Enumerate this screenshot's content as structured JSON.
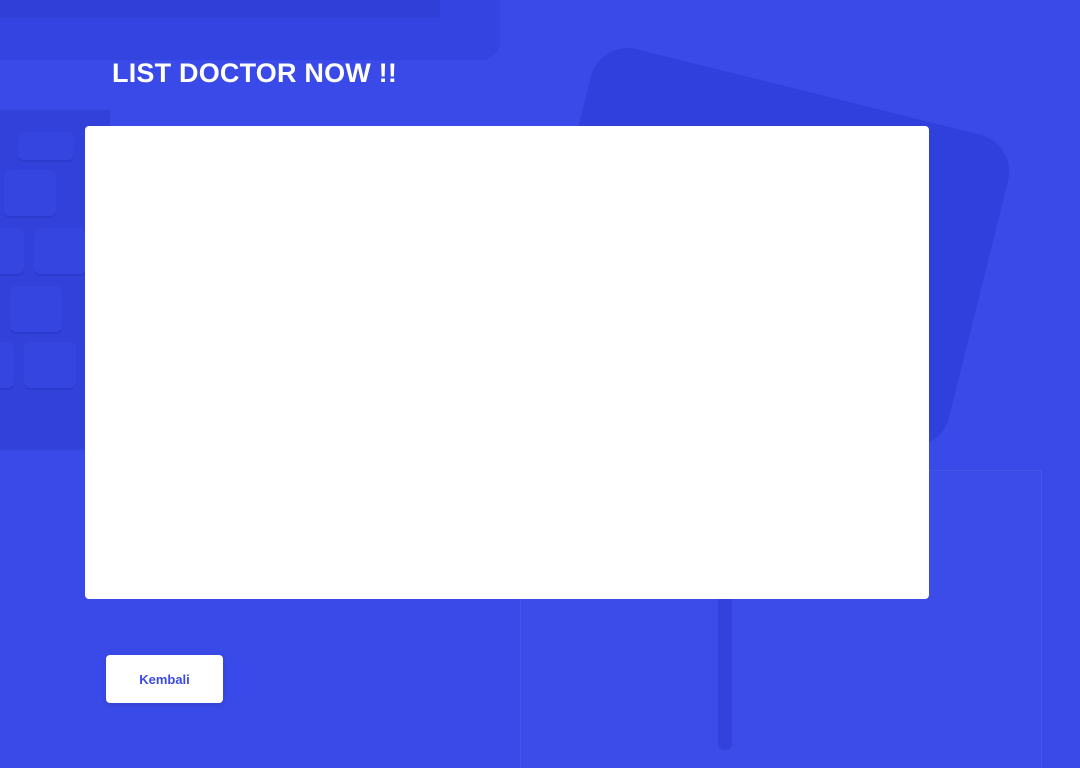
{
  "header": {
    "title": "LIST DOCTOR NOW !!"
  },
  "main": {
    "doctor_list": []
  },
  "footer": {
    "back_label": "Kembali"
  },
  "colors": {
    "background": "#3a4ae8",
    "panel": "#ffffff",
    "button_text": "#3a4ae8",
    "title_text": "#ffffff"
  }
}
